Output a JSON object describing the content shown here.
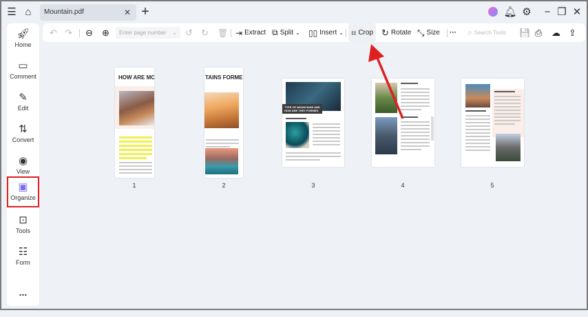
{
  "tab": {
    "title": "Mountain.pdf"
  },
  "sidebar": {
    "items": [
      {
        "label": "Home",
        "icon": "rocket-icon"
      },
      {
        "label": "Comment",
        "icon": "comment-icon"
      },
      {
        "label": "Edit",
        "icon": "edit-icon"
      },
      {
        "label": "Convert",
        "icon": "convert-icon"
      },
      {
        "label": "View",
        "icon": "eye-icon"
      },
      {
        "label": "Organize",
        "icon": "organize-icon",
        "active": true
      },
      {
        "label": "Tools",
        "icon": "toolbox-icon"
      },
      {
        "label": "Form",
        "icon": "form-icon"
      },
      {
        "label": "...",
        "icon": "more-icon"
      }
    ]
  },
  "toolbar": {
    "page_placeholder": "Enter page number",
    "extract": "Extract",
    "split": "Split",
    "insert": "Insert",
    "crop": "Crop",
    "rotate": "Rotate",
    "size": "Size",
    "search_placeholder": "Search Tools"
  },
  "pages": [
    {
      "number": "1",
      "heading": "HOW ARE MOUNT"
    },
    {
      "number": "2",
      "heading": "TAINS FORMED?"
    },
    {
      "number": "3",
      "heading": "TYPE OF MOUNTAINS AND HOW ARE THEY FORMED"
    },
    {
      "number": "4"
    },
    {
      "number": "5"
    }
  ],
  "colors": {
    "highlight_box": "#e02020",
    "arrow": "#e02020",
    "accent": "#4a6cf7"
  }
}
